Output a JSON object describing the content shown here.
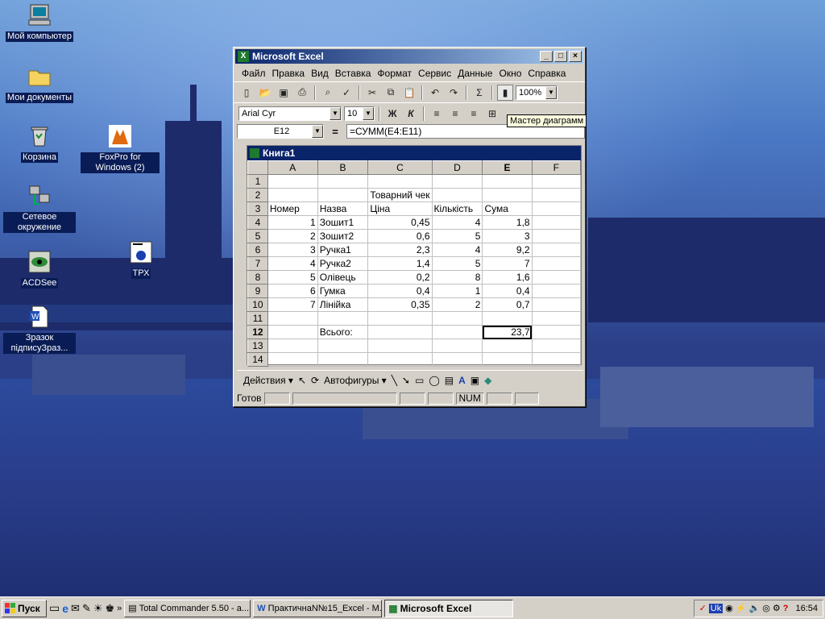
{
  "desktop": {
    "icons": [
      {
        "label": "Мой компьютер",
        "icon": "computer-icon"
      },
      {
        "label": "Мои документы",
        "icon": "folder-icon"
      },
      {
        "label": "Корзина",
        "icon": "recycle-bin-icon"
      },
      {
        "label": "FoxPro for Windows (2)",
        "icon": "foxpro-icon"
      },
      {
        "label": "Сетевое окружение",
        "icon": "network-icon"
      },
      {
        "label": "ТРХ",
        "icon": "trx-icon"
      },
      {
        "label": "ACDSee",
        "icon": "acdsee-icon"
      },
      {
        "label": "Зразок підписуЗраз...",
        "icon": "word-doc-icon"
      }
    ]
  },
  "excel": {
    "title": "Microsoft Excel",
    "menu": [
      "Файл",
      "Правка",
      "Вид",
      "Вставка",
      "Формат",
      "Сервис",
      "Данные",
      "Окно",
      "Справка"
    ],
    "zoom": "100%",
    "font_name": "Arial Cyr",
    "font_size": "10",
    "bold_label": "Ж",
    "italic_label": "К",
    "sum_label": "Σ",
    "tooltip": "Мастер диаграмм",
    "name_box": "E12",
    "formula": "=СУММ(E4:E11)",
    "workbook_title": "Книга1",
    "columns": [
      "A",
      "B",
      "C",
      "D",
      "E",
      "F"
    ],
    "rows": [
      [
        "1",
        "",
        "",
        "",
        "",
        "",
        ""
      ],
      [
        "2",
        "",
        "",
        "Товарний чек",
        "",
        "",
        ""
      ],
      [
        "3",
        "Номер",
        "Назва",
        "Ціна",
        "Кількість",
        "Сума",
        ""
      ],
      [
        "4",
        "1",
        "Зошит1",
        "0,45",
        "4",
        "1,8",
        ""
      ],
      [
        "5",
        "2",
        "Зошит2",
        "0,6",
        "5",
        "3",
        ""
      ],
      [
        "6",
        "3",
        "Ручка1",
        "2,3",
        "4",
        "9,2",
        ""
      ],
      [
        "7",
        "4",
        "Ручка2",
        "1,4",
        "5",
        "7",
        ""
      ],
      [
        "8",
        "5",
        "Олівець",
        "0,2",
        "8",
        "1,6",
        ""
      ],
      [
        "9",
        "6",
        "Гумка",
        "0,4",
        "1",
        "0,4",
        ""
      ],
      [
        "10",
        "7",
        "Лінійка",
        "0,35",
        "2",
        "0,7",
        ""
      ],
      [
        "11",
        "",
        "",
        "",
        "",
        "",
        ""
      ],
      [
        "12",
        "",
        "Всього:",
        "",
        "",
        "23,7",
        ""
      ],
      [
        "13",
        "",
        "",
        "",
        "",
        "",
        ""
      ],
      [
        "14",
        "",
        "",
        "",
        "",
        "",
        ""
      ]
    ],
    "drawing": {
      "actions_label": "Действия ▾",
      "autoshapes_label": "Автофигуры ▾"
    },
    "status": {
      "ready": "Готов",
      "num": "NUM"
    }
  },
  "taskbar": {
    "start_label": "Пуск",
    "tasks": [
      "Total Commander 5.50 - а...",
      "ПрактичнаN№15_Excel - M...",
      "Microsoft Excel"
    ],
    "lang": "Uk",
    "clock": "16:54"
  }
}
